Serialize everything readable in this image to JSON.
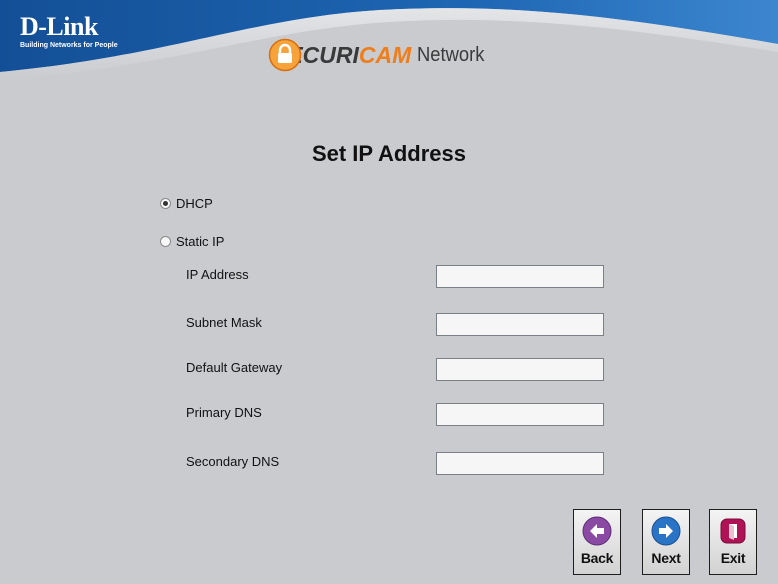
{
  "brand": {
    "name": "D-Link",
    "tagline": "Building Networks for People"
  },
  "product": {
    "name_part1": "SECURI",
    "name_part2": "CAM",
    "name_part3": "Network"
  },
  "page_title": "Set IP Address",
  "mode": {
    "selected": "DHCP",
    "dhcp_label": "DHCP",
    "static_label": "Static IP"
  },
  "fields": {
    "ip_address": {
      "label": "IP Address",
      "value": ""
    },
    "subnet_mask": {
      "label": "Subnet Mask",
      "value": ""
    },
    "default_gateway": {
      "label": "Default Gateway",
      "value": ""
    },
    "primary_dns": {
      "label": "Primary DNS",
      "value": ""
    },
    "secondary_dns": {
      "label": "Secondary DNS",
      "value": ""
    }
  },
  "buttons": {
    "back": "Back",
    "next": "Next",
    "exit": "Exit"
  },
  "colors": {
    "header_blue": "#16559f",
    "background": "#c9cbcf",
    "accent_orange": "#ef7d1a",
    "back_icon": "#8a4aa3",
    "next_icon": "#2a74c8",
    "exit_icon": "#b01355"
  },
  "icons": {
    "lock": "lock-icon",
    "back": "arrow-left-icon",
    "next": "arrow-right-icon",
    "exit": "exit-door-icon"
  }
}
